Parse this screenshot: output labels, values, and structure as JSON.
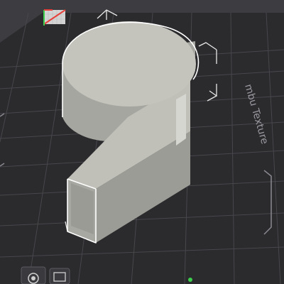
{
  "app": {
    "view": "3d-slicer-viewport"
  },
  "plate": {
    "texture_label": "mbu Texture"
  },
  "model": {
    "shape": "number-9",
    "selected": true
  },
  "toolbar": {
    "icons": [
      "printer-view-icon",
      "layer-view-icon"
    ]
  },
  "colors": {
    "background": "#3d3d41",
    "plate": "#2b2b2e",
    "grid_line": "#4a4a4f",
    "model_top": "#c4c4bd",
    "model_side": "#a6a6a0",
    "model_edge": "#ffffff",
    "axis_x": "#e8413c",
    "axis_y": "#3ccf4e",
    "origin_marker": "#d9d9d9"
  }
}
